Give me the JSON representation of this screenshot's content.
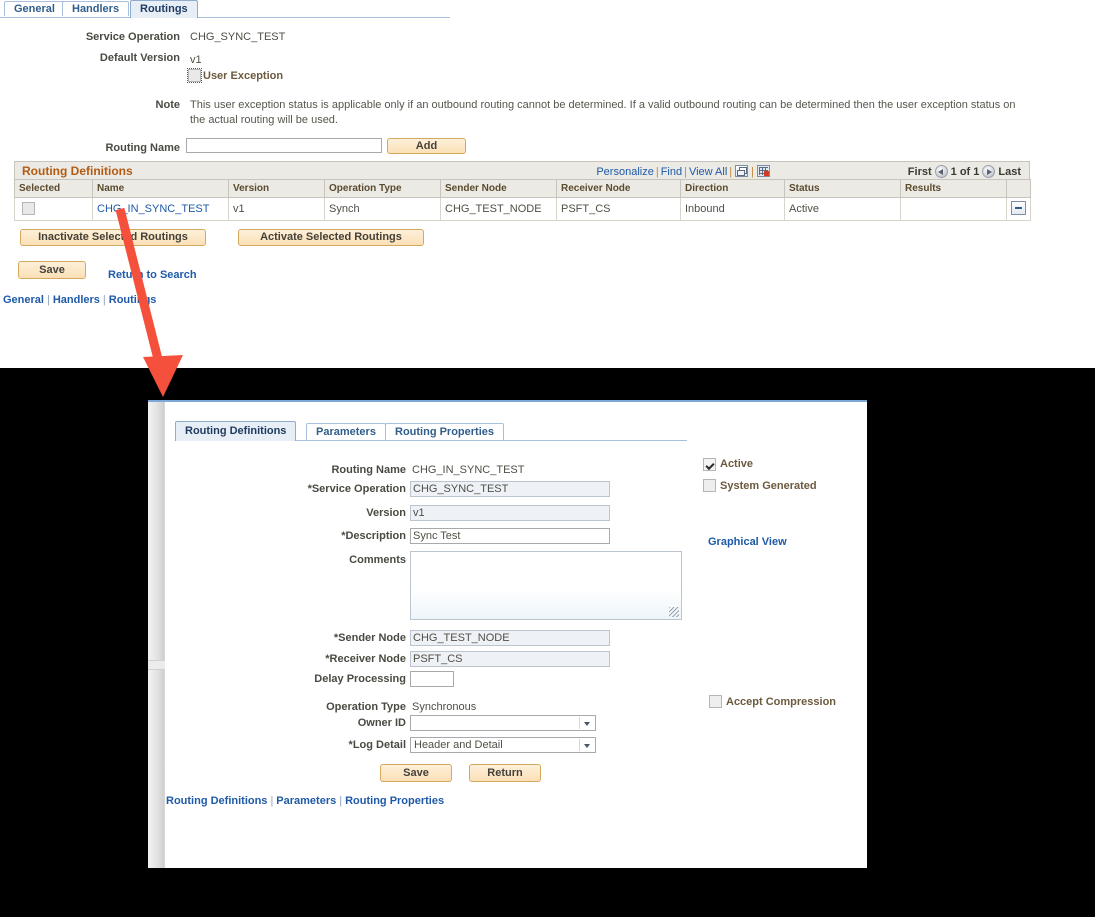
{
  "top_page": {
    "tabs": [
      {
        "label": "General",
        "active": false
      },
      {
        "label": "Handlers",
        "active": false
      },
      {
        "label": "Routings",
        "active": true
      }
    ],
    "fields": {
      "service_operation_label": "Service Operation",
      "service_operation_value": "CHG_SYNC_TEST",
      "default_version_label": "Default Version",
      "default_version_value": "v1",
      "user_exception_label": "User Exception",
      "note_label": "Note",
      "note_text": "This user exception status is applicable only if an outbound routing cannot be determined.  If a valid outbound routing can be determined then the user exception status on the actual routing will be used.",
      "routing_name_label": "Routing Name",
      "routing_name_value": "",
      "routing_name_placeholder": ""
    },
    "add_button_label": "Add",
    "grid": {
      "title": "Routing Definitions",
      "toolbar": {
        "personalize": "Personalize",
        "find": "Find",
        "view_all": "View All",
        "separator": "|",
        "expand_icon": "expand-window-icon",
        "download_icon": "download-grid-icon"
      },
      "pager": {
        "first": "First",
        "count": "1 of 1",
        "last": "Last",
        "prev_icon": "prev-arrow-icon",
        "next_icon": "next-arrow-icon"
      },
      "columns": [
        "Selected",
        "Name",
        "Version",
        "Operation Type",
        "Sender Node",
        "Receiver Node",
        "Direction",
        "Status",
        "Results",
        ""
      ],
      "rows": [
        {
          "selected": false,
          "name": "CHG_IN_SYNC_TEST",
          "version": "v1",
          "operation_type": "Synch",
          "sender_node": "CHG_TEST_NODE",
          "receiver_node": "PSFT_CS",
          "direction": "Inbound",
          "status": "Active",
          "results": "",
          "delete_icon": "minus-delete-icon"
        }
      ]
    },
    "buttons": {
      "inactivate": "Inactivate Selected Routings",
      "activate": "Activate Selected Routings",
      "save": "Save",
      "return_to_search": "Return to Search"
    },
    "footer_links": [
      "General",
      "Handlers",
      "Routings"
    ],
    "footer_separator": "|"
  },
  "zoom_panel": {
    "tabs": [
      {
        "label": "Routing Definitions",
        "active": true
      },
      {
        "label": "Parameters",
        "active": false
      },
      {
        "label": "Routing Properties",
        "active": false
      }
    ],
    "fields": {
      "routing_name_label": "Routing Name",
      "routing_name_value": "CHG_IN_SYNC_TEST",
      "service_operation_label": "*Service Operation",
      "service_operation_value": "CHG_SYNC_TEST",
      "version_label": "Version",
      "version_value": "v1",
      "description_label": "*Description",
      "description_value": "Sync Test",
      "comments_label": "Comments",
      "comments_value": "",
      "sender_node_label": "*Sender Node",
      "sender_node_value": "CHG_TEST_NODE",
      "receiver_node_label": "*Receiver Node",
      "receiver_node_value": "PSFT_CS",
      "delay_processing_label": "Delay Processing",
      "delay_processing_value": "",
      "operation_type_label": "Operation Type",
      "operation_type_value": "Synchronous",
      "owner_id_label": "Owner ID",
      "owner_id_value": "",
      "log_detail_label": "*Log Detail",
      "log_detail_value": "Header and Detail"
    },
    "checkboxes": {
      "active_label": "Active",
      "active_checked": true,
      "system_generated_label": "System Generated",
      "system_generated_checked": false,
      "accept_compression_label": "Accept Compression",
      "accept_compression_checked": false
    },
    "graphical_view_link": "Graphical View",
    "buttons": {
      "save": "Save",
      "return": "Return"
    },
    "footer_links": [
      "Routing Definitions",
      "Parameters",
      "Routing Properties"
    ],
    "footer_separator": "|"
  },
  "annotation": {
    "arrow_color": "#f4503c",
    "arrow_name": "red-callout-arrow"
  }
}
